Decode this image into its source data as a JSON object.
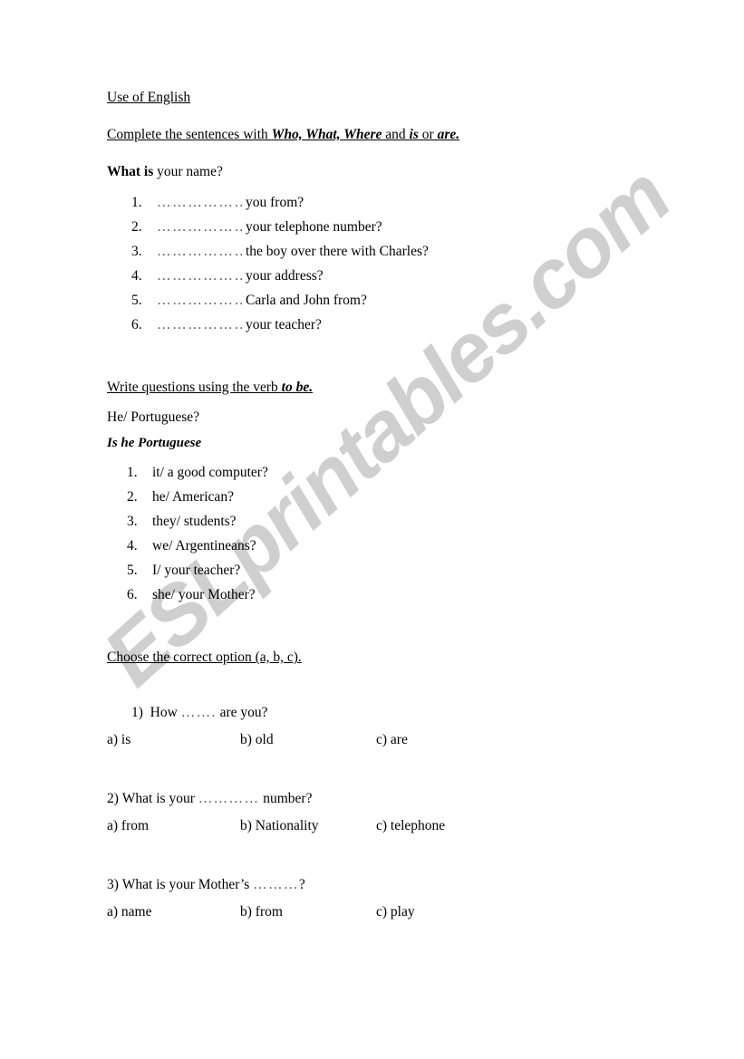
{
  "watermark": {
    "text": "ESLprintables.com",
    "color": "#cfcfcf"
  },
  "document": {
    "title": "Use of English",
    "section1": {
      "instruction_prefix": "Complete the sentences with ",
      "instruction_bold1": "Who, What, Where",
      "instruction_mid": " and ",
      "instruction_bold2": "is",
      "instruction_mid2": " or ",
      "instruction_bold3": "are.",
      "example_bold": "What is",
      "example_rest": " your name?",
      "dots": "………………",
      "items": [
        {
          "num": "1.",
          "dots": "………………",
          "text": "you from?"
        },
        {
          "num": "2.",
          "dots": "………………",
          "text": "your telephone number?"
        },
        {
          "num": "3.",
          "dots": "………………",
          "text": "the boy over there with Charles?"
        },
        {
          "num": "4.",
          "dots": "………………",
          "text": "your address?"
        },
        {
          "num": "5.",
          "dots": "………………",
          "text": "Carla and John from?"
        },
        {
          "num": "6.",
          "dots": "………………",
          "text": " your teacher?"
        }
      ]
    },
    "section2": {
      "instruction_prefix": "Write questions using the verb ",
      "instruction_bold": "to be.",
      "prompt": "He/ Portuguese?",
      "answer": "Is he Portuguese",
      "items": [
        {
          "num": "1.",
          "text": "it/ a good computer?"
        },
        {
          "num": "2.",
          "text": "he/ American?"
        },
        {
          "num": "3.",
          "text": "they/ students?"
        },
        {
          "num": "4.",
          "text": "we/ Argentineans?"
        },
        {
          "num": "5.",
          "text": "I/ your teacher?"
        },
        {
          "num": "6.",
          "text": "she/ your Mother?"
        }
      ]
    },
    "section3": {
      "instruction": "Choose the correct option (a, b, c).",
      "questions": [
        {
          "label": "1)",
          "pre": "How ",
          "dots": "…….",
          "post": " are you?",
          "options": {
            "a": "a) is",
            "b": "b) old",
            "c": "c) are"
          }
        },
        {
          "label": "2)",
          "pre": "What is your ",
          "dots": "…………",
          "post": " number?",
          "options": {
            "a": "a) from",
            "b": "b) Nationality",
            "c": "c) telephone"
          }
        },
        {
          "label": "3)",
          "pre": "What is your Mother’s ",
          "dots": "………",
          "post": "?",
          "options": {
            "a": "a) name",
            "b": "b) from",
            "c": "c) play"
          }
        }
      ]
    }
  }
}
